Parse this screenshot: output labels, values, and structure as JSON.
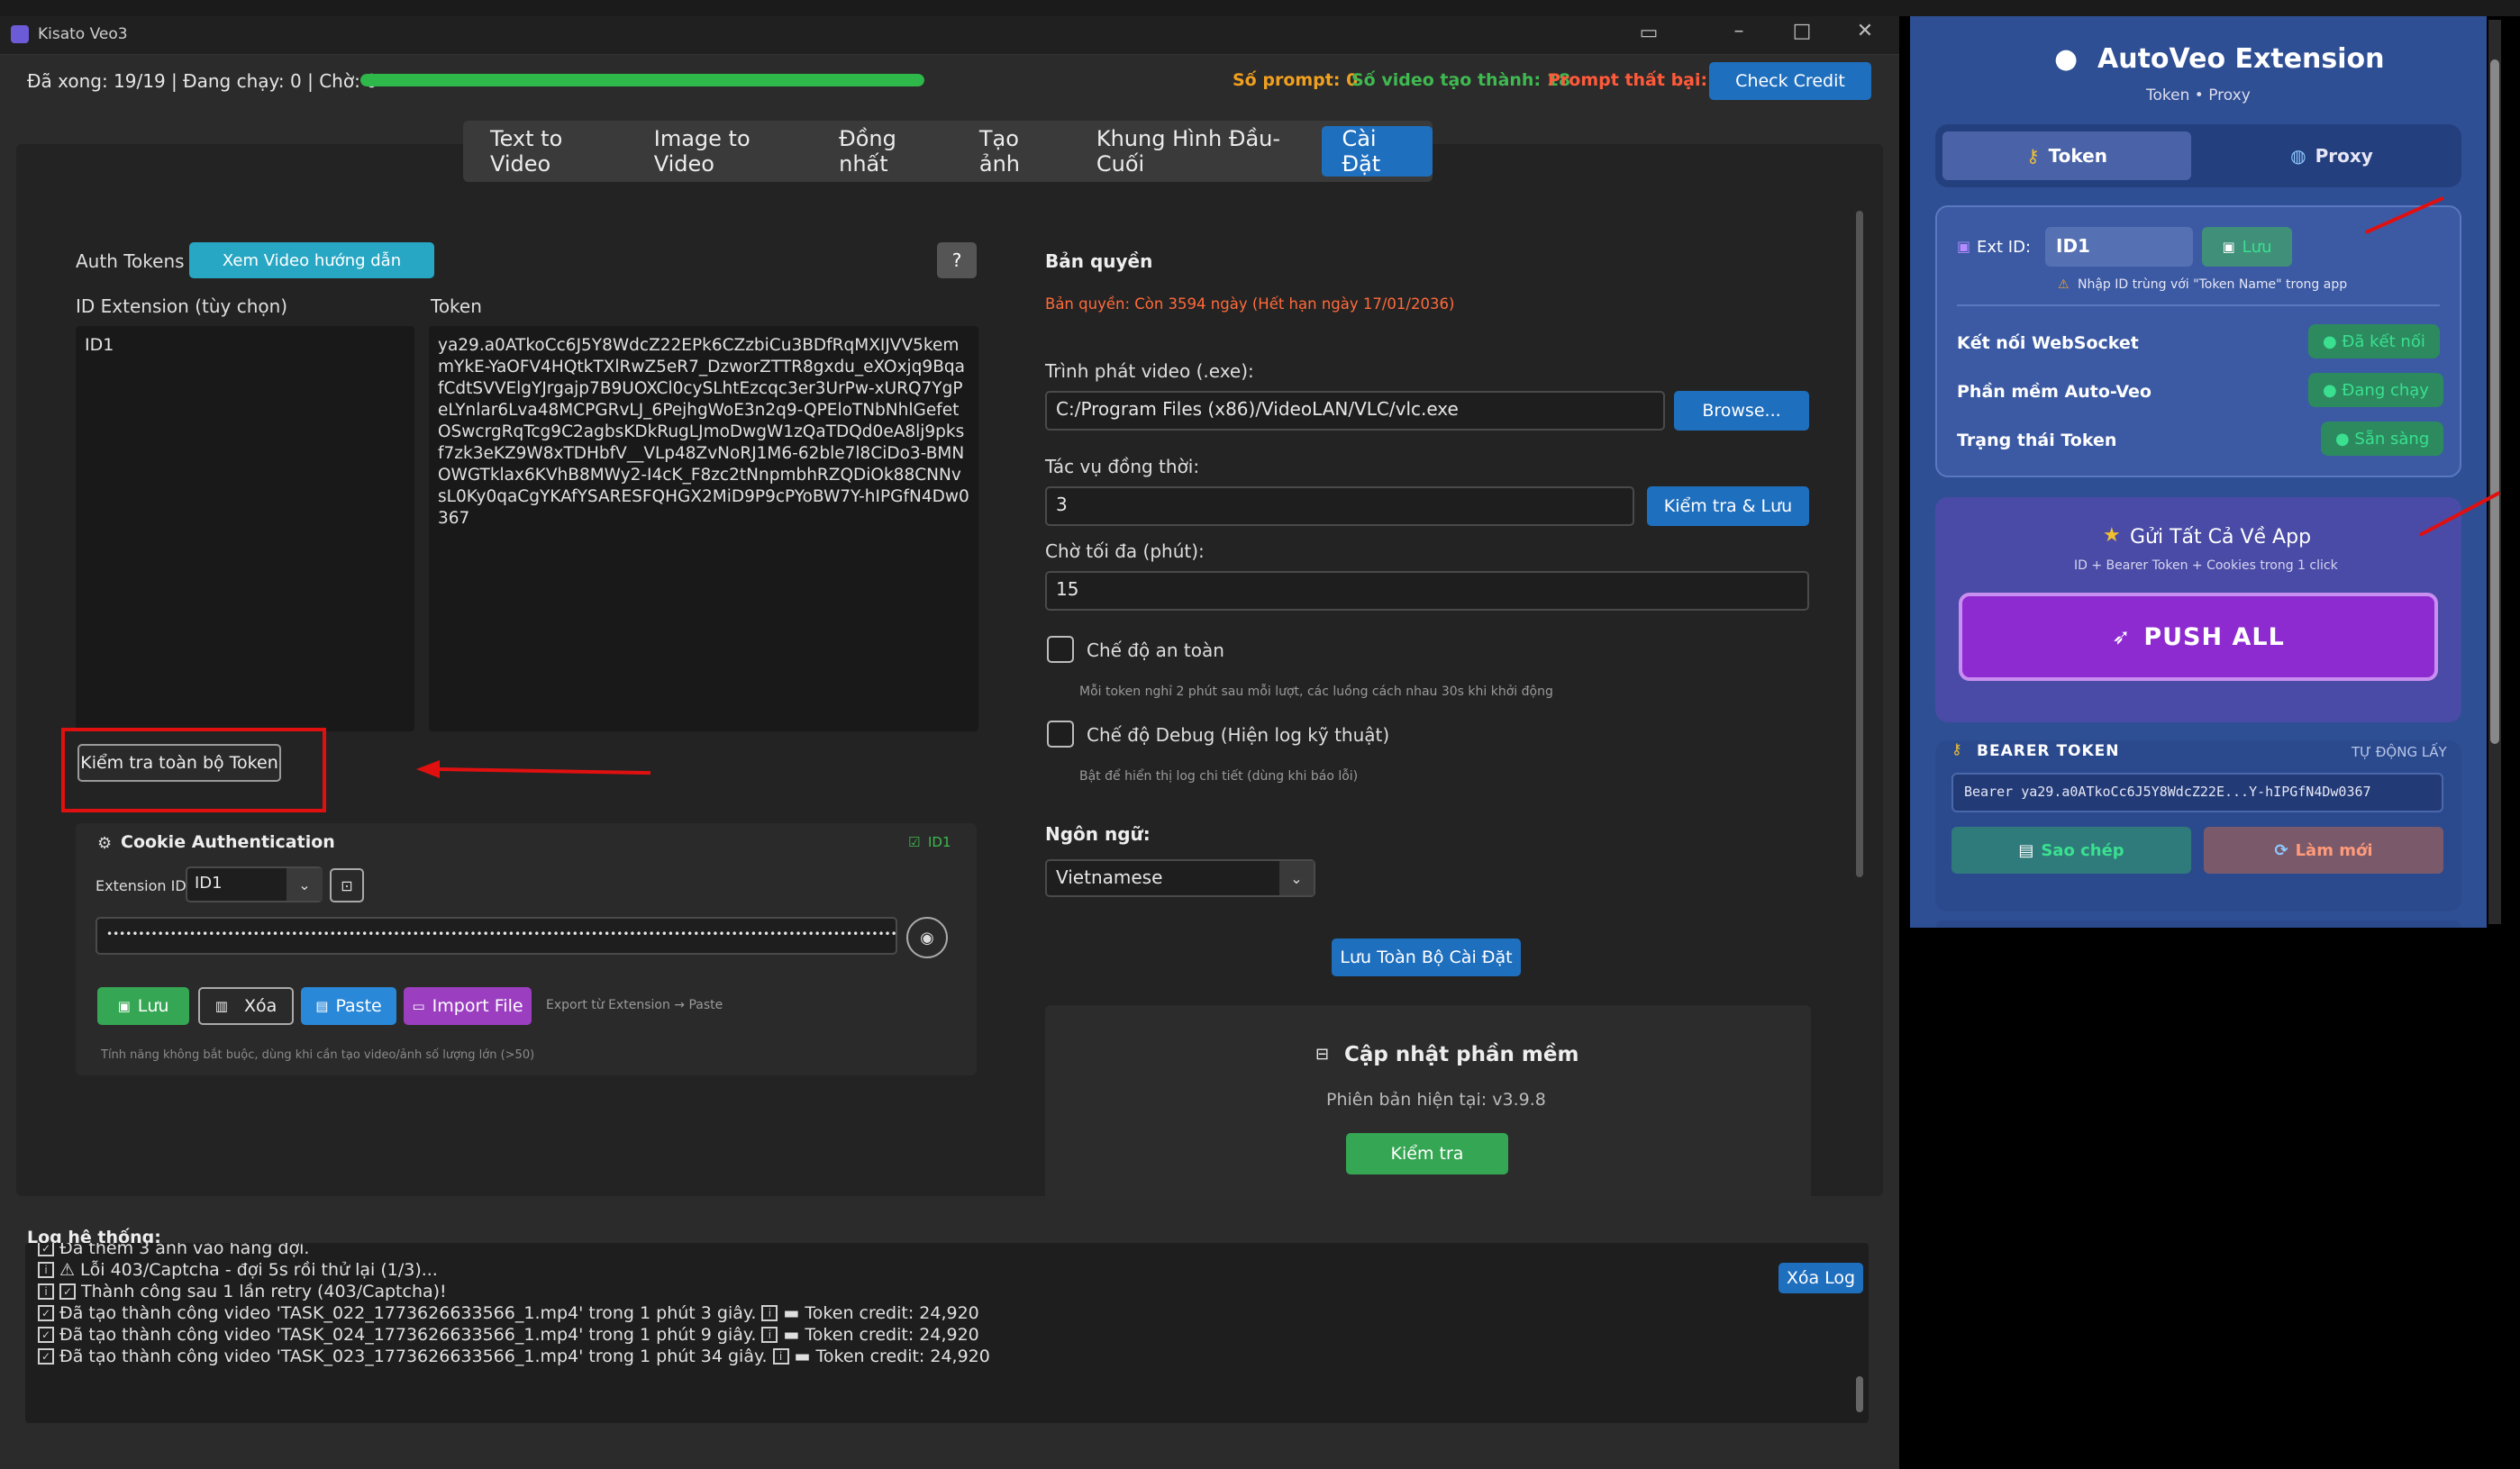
{
  "window": {
    "title": "Kisato Veo3",
    "status_left": "Đã xong: 19/19 | Đang chạy: 0 | Chờ: 0",
    "progress": 1.0,
    "stat_prompt": "Số prompt: 0",
    "stat_done": "Số video tạo thành: 18",
    "stat_fail": "Prompt thất bại: 1",
    "check_credit": "Check Credit"
  },
  "tabs": [
    {
      "label": "Text to Video"
    },
    {
      "label": "Image to Video"
    },
    {
      "label": "Đồng nhất"
    },
    {
      "label": "Tạo ảnh"
    },
    {
      "label": "Khung Hình Đầu-Cuối"
    },
    {
      "label": "Cài Đặt"
    }
  ],
  "auth": {
    "title": "Auth Tokens",
    "video_guide": "Xem Video hướng dẫn",
    "help": "?",
    "col_ext": "ID Extension (tùy chọn)",
    "col_token": "Token",
    "ext_value": "ID1",
    "token_value": "ya29.a0ATkoCc6J5Y8WdcZ22EPk6CZzbiCu3BDfRqMXIJVV5kemmYkE-YaOFV4HQtkTXlRwZ5eR7_DzworZTTR8gxdu_eXOxjq9BqafCdtSVVElgYJrgajp7B9UOXCl0cySLhtEzcqc3er3UrPw-xURQ7YgPeLYnlar6Lva48MCPGRvLJ_6PejhgWoE3n2q9-QPEloTNbNhlGefetOSwcrgRqTcg9C2agbsKDkRugLJmoDwgW1zQaTDQd0eA8lj9pksf7zk3eKZ9W8xTDHbfV__VLp48ZvNoRJ1M6-62ble7l8CiDo3-BMNOWGTklax6KVhB8MWy2-I4cK_F8zc2tNnpmbhRZQDiOk88CNNvsL0Ky0qaCgYKAfYSARESFQHGX2MiD9P9cPYoBW7Y-hIPGfN4Dw0367",
    "check_all": "Kiểm tra toàn bộ Token"
  },
  "cookie": {
    "title": "Cookie Authentication",
    "badge": "ID1",
    "ext_label": "Extension ID:",
    "ext_value": "ID1",
    "password_dots": "••••••••••••••••••••••••••••••••••••••••••••••••••••••••••••••••••••••••••••••••••••••••••••••••••••••••••••••••••••••••••••",
    "save": "Lưu",
    "delete": "Xóa",
    "paste": "Paste",
    "import": "Import File",
    "hint": "Export từ Extension → Paste",
    "note": "Tính năng không bắt buộc, dùng khi cần tạo video/ảnh số lượng lớn (>50)"
  },
  "settings": {
    "license_title": "Bản quyền",
    "license_text": "Bản quyền: Còn 3594 ngày (Hết hạn ngày 17/01/2036)",
    "player_label": "Trình phát video (.exe):",
    "player_value": "C:/Program Files (x86)/VideoLAN/VLC/vlc.exe",
    "browse": "Browse...",
    "concurrent_label": "Tác vụ đồng thời:",
    "concurrent_value": "3",
    "check_save": "Kiểm tra & Lưu",
    "wait_label": "Chờ tối đa (phút):",
    "wait_value": "15",
    "safe_mode": "Chế độ an toàn",
    "safe_desc": "Mỗi token nghỉ 2 phút sau mỗi lượt, các luồng cách nhau 30s khi khởi động",
    "debug_mode": "Chế độ Debug (Hiện log kỹ thuật)",
    "debug_desc": "Bật để hiển thị log chi tiết (dùng khi báo lỗi)",
    "lang_label": "Ngôn ngữ:",
    "lang_value": "Vietnamese",
    "save_all": "Lưu Toàn Bộ Cài Đặt",
    "update_title": "Cập nhật phần mềm",
    "version": "Phiên bản hiện tại: v3.9.8",
    "check": "Kiểm tra"
  },
  "log": {
    "title": "Log hệ thống:",
    "clear": "Xóa Log",
    "lines": [
      "Đã thêm 3 ảnh vào hàng đợi.",
      "Lỗi 403/Captcha - đợi 5s rồi thử lại (1/3)...",
      "Thành công sau 1 lần retry (403/Captcha)!",
      "Đã tạo thành công video 'TASK_022_1773626633566_1.mp4' trong 1 phút 3 giây.",
      "Đã tạo thành công video 'TASK_024_1773626633566_1.mp4' trong 1 phút 9 giây.",
      "Đã tạo thành công video 'TASK_023_1773626633566_1.mp4' trong 1 phút 34 giây."
    ],
    "credit": "Token credit: 24,920"
  },
  "ext": {
    "title": "AutoVeo Extension",
    "subtitle": "Token • Proxy",
    "tab_token": "Token",
    "tab_proxy": "Proxy",
    "ext_id_label": "Ext ID:",
    "ext_id_value": "ID1",
    "save": "Lưu",
    "warn": "Nhập ID trùng với \"Token Name\" trong app",
    "rows": [
      {
        "label": "Kết nối WebSocket",
        "status": "● Đã kết nối"
      },
      {
        "label": "Phần mềm Auto-Veo",
        "status": "● Đang chạy"
      },
      {
        "label": "Trạng thái Token",
        "status": "● Sẵn sàng"
      }
    ],
    "send_all": "Gửi Tất Cả Về App",
    "send_desc": "ID + Bearer Token + Cookies trong 1 click",
    "push_all": "PUSH ALL",
    "bearer_title": "BEARER TOKEN",
    "auto": "TỰ ĐỘNG LẤY",
    "bearer_value": "Bearer ya29.a0ATkoCc6J5Y8WdcZ22E...Y-hIPGfN4Dw0367",
    "copy": "Sao chép",
    "refresh": "Làm mới"
  },
  "colors": {
    "accent": "#1f6fbf",
    "green": "#3fb950",
    "purple": "#8e2bd0",
    "red": "#e01010",
    "orange": "#f0a020"
  }
}
